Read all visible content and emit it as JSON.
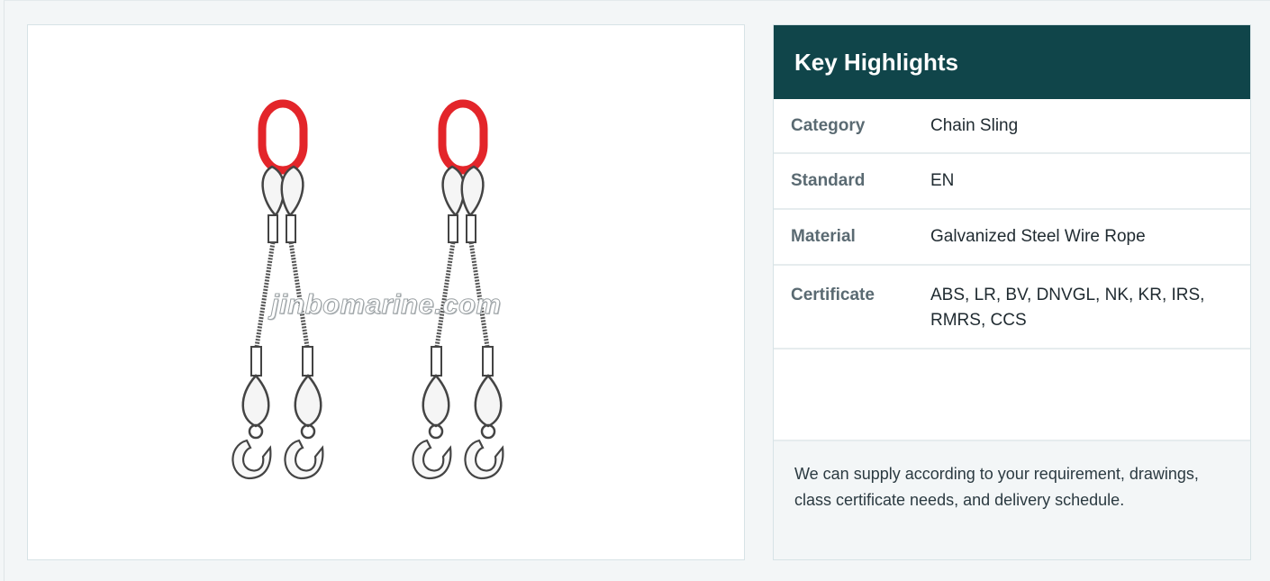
{
  "image": {
    "alt": "Two-leg wire rope sling illustration",
    "watermark": "jinbomarine.com",
    "colors": {
      "master_link": "#e3252a",
      "rope": "#555555"
    }
  },
  "highlights": {
    "title": "Key Highlights",
    "rows": [
      {
        "label": "Category",
        "value": "Chain Sling"
      },
      {
        "label": "Standard",
        "value": "EN"
      },
      {
        "label": "Material",
        "value": "Galvanized Steel Wire Rope"
      },
      {
        "label": "Certificate",
        "value": "ABS, LR, BV, DNVGL, NK, KR, IRS, RMRS, CCS"
      }
    ],
    "note": "We can supply according to your requirement, drawings, class certificate needs, and delivery schedule."
  },
  "theme": {
    "header_bg": "#10454a",
    "page_bg": "#f3f6f7",
    "border": "#d7e3e6"
  }
}
